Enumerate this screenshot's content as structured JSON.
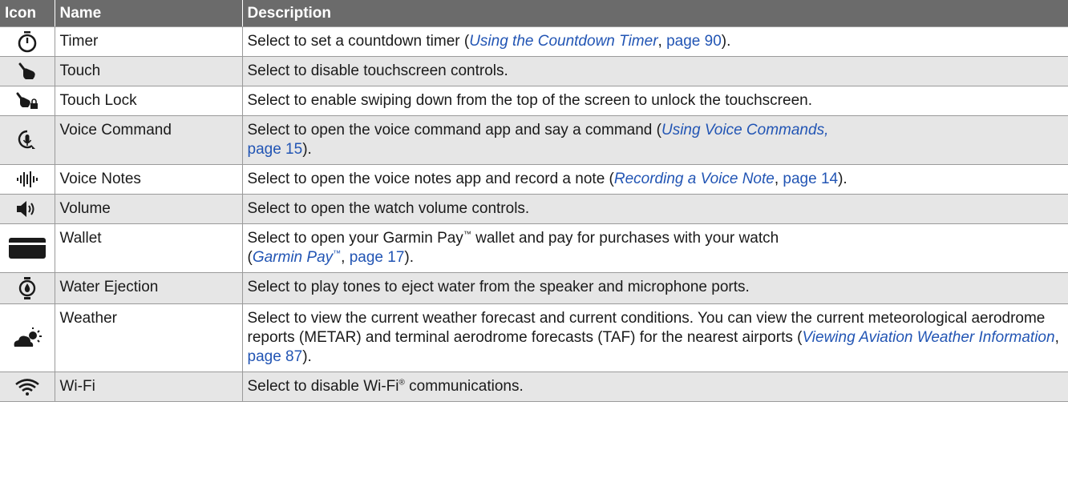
{
  "headers": {
    "icon": "Icon",
    "name": "Name",
    "description": "Description"
  },
  "rows": [
    {
      "icon": "timer-icon",
      "name": "Timer",
      "desc_pre": "Select to set a countdown timer (",
      "link": "Using the Countdown Timer",
      "link_sep": ", ",
      "page": "page 90",
      "desc_post": ")."
    },
    {
      "icon": "touch-icon",
      "name": "Touch",
      "desc": "Select to disable touchscreen controls."
    },
    {
      "icon": "touch-lock-icon",
      "name": "Touch Lock",
      "desc": "Select to enable swiping down from the top of the screen to unlock the touchscreen."
    },
    {
      "icon": "voice-command-icon",
      "name": "Voice Command",
      "desc_pre": "Select to open the voice command app and say a command (",
      "link": "Using Voice Commands",
      "link_sep": ",",
      "page": "page 15",
      "desc_post": ")."
    },
    {
      "icon": "voice-notes-icon",
      "name": "Voice Notes",
      "desc_pre": "Select to open the voice notes app and record a note (",
      "link": "Recording a Voice Note",
      "link_sep": ", ",
      "page": "page 14",
      "desc_post": ")."
    },
    {
      "icon": "volume-icon",
      "name": "Volume",
      "desc": "Select to open the watch volume controls."
    },
    {
      "icon": "wallet-icon",
      "name": "Wallet",
      "desc_pre": "Select to open your Garmin Pay",
      "tm": "™",
      "desc_mid": " wallet and pay for purchases with your watch",
      "desc_open": "(",
      "link": "Garmin Pay",
      "link_tm": "™",
      "link_sep": ", ",
      "page": "page 17",
      "desc_post": ")."
    },
    {
      "icon": "water-ejection-icon",
      "name": "Water Ejection",
      "desc": "Select to play tones to eject water from the speaker and microphone ports."
    },
    {
      "icon": "weather-icon",
      "name": "Weather",
      "desc_pre": "Select to view the current weather forecast and current conditions. You can view the current meteorological aerodrome reports (METAR) and terminal aerodrome forecasts (TAF) for the nearest airports (",
      "link": "Viewing Aviation Weather Information",
      "link_sep": ", ",
      "page": "page 87",
      "desc_post": ")."
    },
    {
      "icon": "wifi-icon",
      "name": "Wi-Fi",
      "desc_pre": "Select to disable Wi-Fi",
      "reg": "®",
      "desc_post": " communications."
    }
  ]
}
